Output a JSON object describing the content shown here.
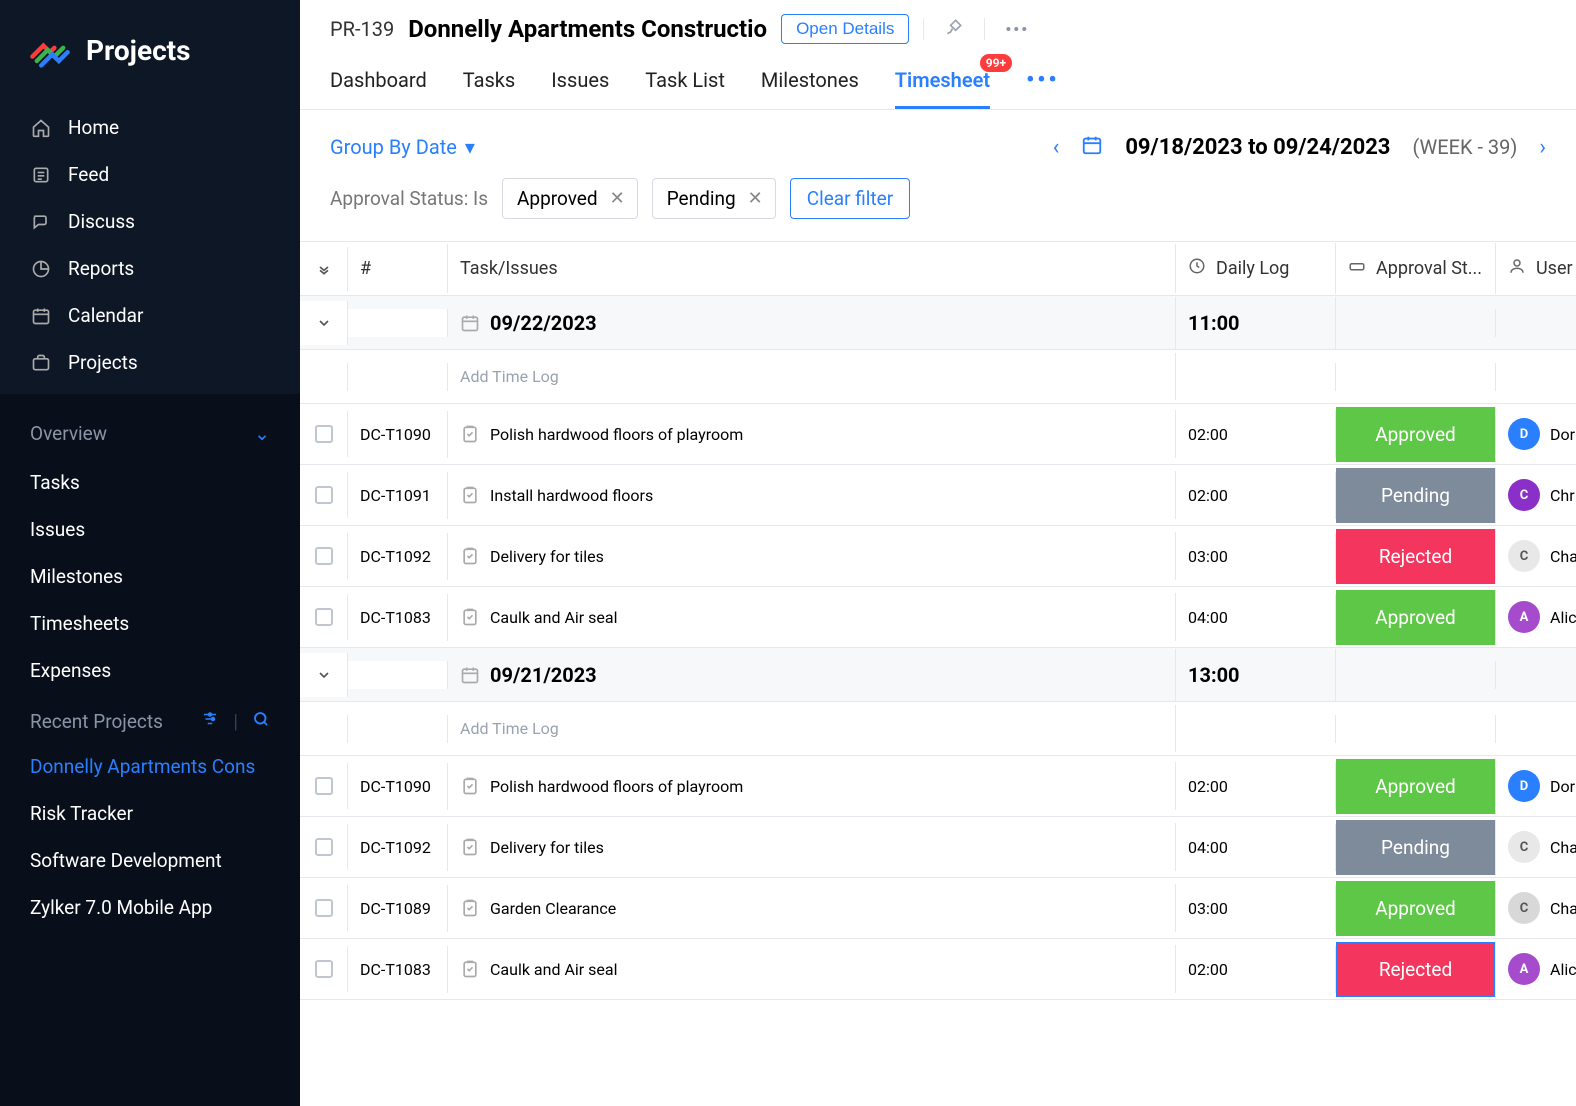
{
  "brand": "Projects",
  "nav": [
    {
      "icon": "home",
      "label": "Home"
    },
    {
      "icon": "feed",
      "label": "Feed"
    },
    {
      "icon": "discuss",
      "label": "Discuss"
    },
    {
      "icon": "reports",
      "label": "Reports"
    },
    {
      "icon": "calendar",
      "label": "Calendar"
    },
    {
      "icon": "projects",
      "label": "Projects"
    }
  ],
  "overview": {
    "title": "Overview",
    "items": [
      "Tasks",
      "Issues",
      "Milestones",
      "Timesheets",
      "Expenses"
    ]
  },
  "recent": {
    "title": "Recent Projects",
    "items": [
      {
        "label": "Donnelly Apartments Cons",
        "active": true
      },
      {
        "label": "Risk Tracker",
        "active": false
      },
      {
        "label": "Software Development",
        "active": false
      },
      {
        "label": "Zylker 7.0 Mobile App",
        "active": false
      }
    ]
  },
  "header": {
    "project_id": "PR-139",
    "project_name": "Donnelly Apartments Constructio",
    "open_details": "Open Details",
    "tabs": [
      "Dashboard",
      "Tasks",
      "Issues",
      "Task List",
      "Milestones",
      "Timesheet"
    ],
    "active_tab": 5,
    "badge": "99+"
  },
  "toolbar": {
    "group_by": "Group By Date",
    "date_range": "09/18/2023 to 09/24/2023",
    "week": "(WEEK - 39)"
  },
  "filter": {
    "label": "Approval Status: Is",
    "chips": [
      "Approved",
      "Pending"
    ],
    "clear": "Clear filter"
  },
  "columns": {
    "id": "#",
    "task": "Task/Issues",
    "log": "Daily Log",
    "approval": "Approval St...",
    "user": "User"
  },
  "add_time_log": "Add Time Log",
  "groups": [
    {
      "date": "09/22/2023",
      "total": "11:00",
      "rows": [
        {
          "id": "DC-T1090",
          "task": "Polish hardwood floors of playroom",
          "log": "02:00",
          "status": "Approved",
          "status_class": "st-approved",
          "user": "Dor",
          "av_bg": "#2a7fff",
          "av_fg": "#fff",
          "av_txt": "D"
        },
        {
          "id": "DC-T1091",
          "task": "Install hardwood floors",
          "log": "02:00",
          "status": "Pending",
          "status_class": "st-pending",
          "user": "Chr",
          "av_bg": "#8b2fc9",
          "av_fg": "#fff",
          "av_txt": "C"
        },
        {
          "id": "DC-T1092",
          "task": "Delivery for tiles",
          "log": "03:00",
          "status": "Rejected",
          "status_class": "st-rejected",
          "user": "Cha",
          "av_bg": "#e8e8e8",
          "av_fg": "#555",
          "av_txt": "C"
        },
        {
          "id": "DC-T1083",
          "task": "Caulk and Air seal",
          "log": "04:00",
          "status": "Approved",
          "status_class": "st-approved",
          "user": "Alic",
          "av_bg": "#a74bcd",
          "av_fg": "#fff",
          "av_txt": "A"
        }
      ]
    },
    {
      "date": "09/21/2023",
      "total": "13:00",
      "rows": [
        {
          "id": "DC-T1090",
          "task": "Polish hardwood floors of playroom",
          "log": "02:00",
          "status": "Approved",
          "status_class": "st-approved",
          "user": "Dor",
          "av_bg": "#2a7fff",
          "av_fg": "#fff",
          "av_txt": "D"
        },
        {
          "id": "DC-T1092",
          "task": "Delivery for tiles",
          "log": "04:00",
          "status": "Pending",
          "status_class": "st-pending",
          "user": "Cha",
          "av_bg": "#e8e8e8",
          "av_fg": "#555",
          "av_txt": "C"
        },
        {
          "id": "DC-T1089",
          "task": "Garden Clearance",
          "log": "03:00",
          "status": "Approved",
          "status_class": "st-approved",
          "user": "Cha",
          "av_bg": "#d8d8d8",
          "av_fg": "#555",
          "av_txt": "C"
        },
        {
          "id": "DC-T1083",
          "task": "Caulk and Air seal",
          "log": "02:00",
          "status": "Rejected",
          "status_class": "st-rejected focused",
          "user": "Alic",
          "av_bg": "#a74bcd",
          "av_fg": "#fff",
          "av_txt": "A"
        }
      ]
    }
  ]
}
